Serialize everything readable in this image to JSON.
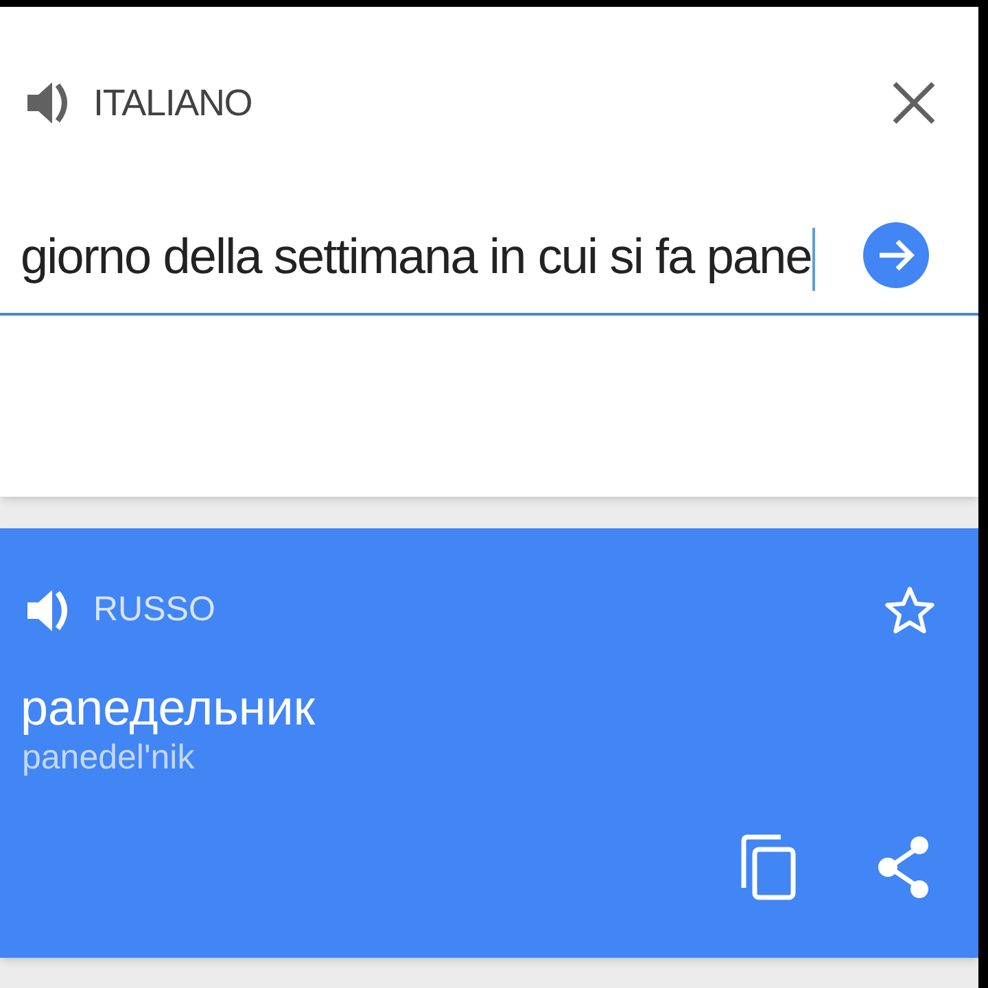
{
  "source": {
    "language": "ITALIANO",
    "text": "giorno della settimana in cui si fa pane"
  },
  "translation": {
    "language": "RUSSO",
    "text": "panедельник",
    "transliteration": "panedel'nik",
    "starred": false
  }
}
